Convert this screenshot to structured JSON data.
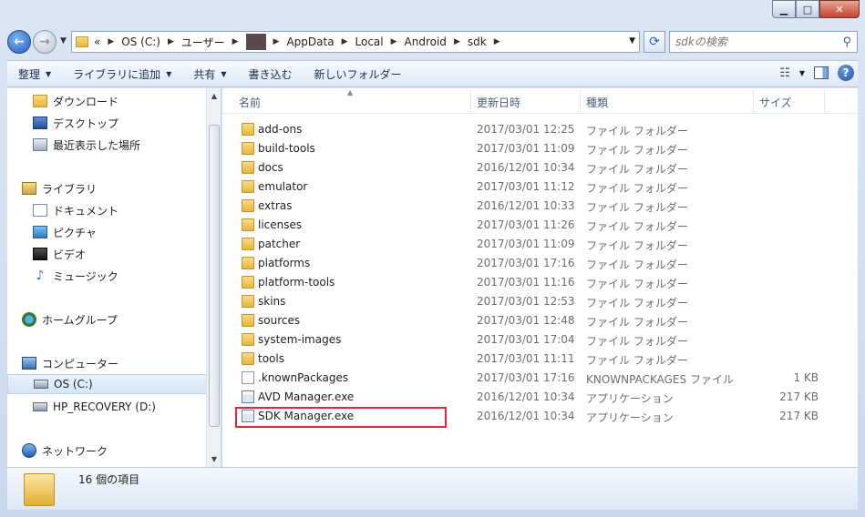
{
  "window": {
    "minimize_glyph": "▁",
    "maximize_glyph": "□",
    "close_glyph": "✕"
  },
  "address": {
    "overflow_label": "«",
    "crumbs": [
      "OS (C:)",
      "ユーザー",
      "AppData",
      "Local",
      "Android",
      "sdk"
    ]
  },
  "search": {
    "placeholder": "sdkの検索"
  },
  "toolbar": {
    "organize": "整理",
    "add_to_library": "ライブラリに追加",
    "share": "共有",
    "burn": "書き込む",
    "new_folder": "新しいフォルダー"
  },
  "nav": {
    "downloads": "ダウンロード",
    "desktop": "デスクトップ",
    "recent": "最近表示した場所",
    "libraries": "ライブラリ",
    "documents": "ドキュメント",
    "pictures": "ピクチャ",
    "videos": "ビデオ",
    "music": "ミュージック",
    "homegroup": "ホームグループ",
    "computer": "コンピューター",
    "drive_c": "OS (C:)",
    "drive_d": "HP_RECOVERY (D:)",
    "network": "ネットワーク"
  },
  "columns": {
    "name": "名前",
    "modified": "更新日時",
    "type": "種類",
    "size": "サイズ"
  },
  "files": [
    {
      "name": "add-ons",
      "date": "2017/03/01 12:25",
      "type": "ファイル フォルダー",
      "size": "",
      "kind": "folder"
    },
    {
      "name": "build-tools",
      "date": "2017/03/01 11:09",
      "type": "ファイル フォルダー",
      "size": "",
      "kind": "folder"
    },
    {
      "name": "docs",
      "date": "2016/12/01 10:34",
      "type": "ファイル フォルダー",
      "size": "",
      "kind": "folder"
    },
    {
      "name": "emulator",
      "date": "2017/03/01 11:12",
      "type": "ファイル フォルダー",
      "size": "",
      "kind": "folder"
    },
    {
      "name": "extras",
      "date": "2016/12/01 10:33",
      "type": "ファイル フォルダー",
      "size": "",
      "kind": "folder"
    },
    {
      "name": "licenses",
      "date": "2017/03/01 11:26",
      "type": "ファイル フォルダー",
      "size": "",
      "kind": "folder"
    },
    {
      "name": "patcher",
      "date": "2017/03/01 11:09",
      "type": "ファイル フォルダー",
      "size": "",
      "kind": "folder"
    },
    {
      "name": "platforms",
      "date": "2017/03/01 17:16",
      "type": "ファイル フォルダー",
      "size": "",
      "kind": "folder"
    },
    {
      "name": "platform-tools",
      "date": "2017/03/01 11:16",
      "type": "ファイル フォルダー",
      "size": "",
      "kind": "folder"
    },
    {
      "name": "skins",
      "date": "2017/03/01 12:53",
      "type": "ファイル フォルダー",
      "size": "",
      "kind": "folder"
    },
    {
      "name": "sources",
      "date": "2017/03/01 12:48",
      "type": "ファイル フォルダー",
      "size": "",
      "kind": "folder"
    },
    {
      "name": "system-images",
      "date": "2017/03/01 17:04",
      "type": "ファイル フォルダー",
      "size": "",
      "kind": "folder"
    },
    {
      "name": "tools",
      "date": "2017/03/01 11:11",
      "type": "ファイル フォルダー",
      "size": "",
      "kind": "folder"
    },
    {
      "name": ".knownPackages",
      "date": "2017/03/01 17:16",
      "type": "KNOWNPACKAGES ファイル",
      "size": "1 KB",
      "kind": "file"
    },
    {
      "name": "AVD Manager.exe",
      "date": "2016/12/01 10:34",
      "type": "アプリケーション",
      "size": "217 KB",
      "kind": "exe"
    },
    {
      "name": "SDK Manager.exe",
      "date": "2016/12/01 10:34",
      "type": "アプリケーション",
      "size": "217 KB",
      "kind": "exe"
    }
  ],
  "status": {
    "item_count": "16 個の項目"
  }
}
